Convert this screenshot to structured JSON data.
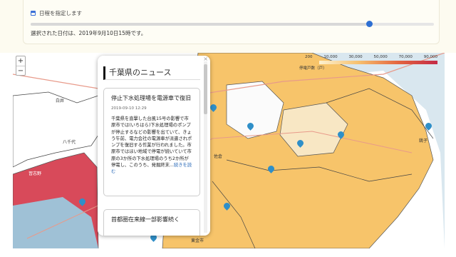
{
  "date_panel": {
    "label": "日程を指定します",
    "slider_position": 0.84,
    "selected_text": "選択された日付は、2019年9月10日15時です。"
  },
  "map": {
    "zoom_in": "+",
    "zoom_out": "−",
    "legend": {
      "ticks": [
        "200",
        "10,000",
        "30,000",
        "50,000",
        "70,000",
        "90,000"
      ],
      "title": "停電戸数（戸）",
      "colors": [
        "#fdf1cf",
        "#f6c06e",
        "#e4653f",
        "#c42a46"
      ]
    },
    "place_labels": [
      "白井",
      "八千代",
      "佐倉",
      "東金市",
      "銚子",
      "習志野"
    ],
    "colors": {
      "sea": "#9fc1d6",
      "low": "#ffffff",
      "mid": "#f7c46a",
      "high": "#d84a5a",
      "marker": "#2f8fc8"
    }
  },
  "popup": {
    "close": "×",
    "title": "千葉県のニュース",
    "news": [
      {
        "title": "停止下水処理場を電源車で復旧",
        "date": "2019-09-10 12:29",
        "body": "千葉県を直撃した台風15号の影響で市原市では(いちはら)下水処理場のポンプが停止するなどの影響を出ていて、きょう午前、電力会社の電源車が派遣されポンプを復旧する作業が行われました。市原市ではほい地域で停電が続いていて市原の3か所の下水処理場のうち2か所が停電し、このうち、発掘終末...",
        "read_more": "続きを読む"
      },
      {
        "title": "首都圏在来線一部影響続く"
      }
    ]
  }
}
